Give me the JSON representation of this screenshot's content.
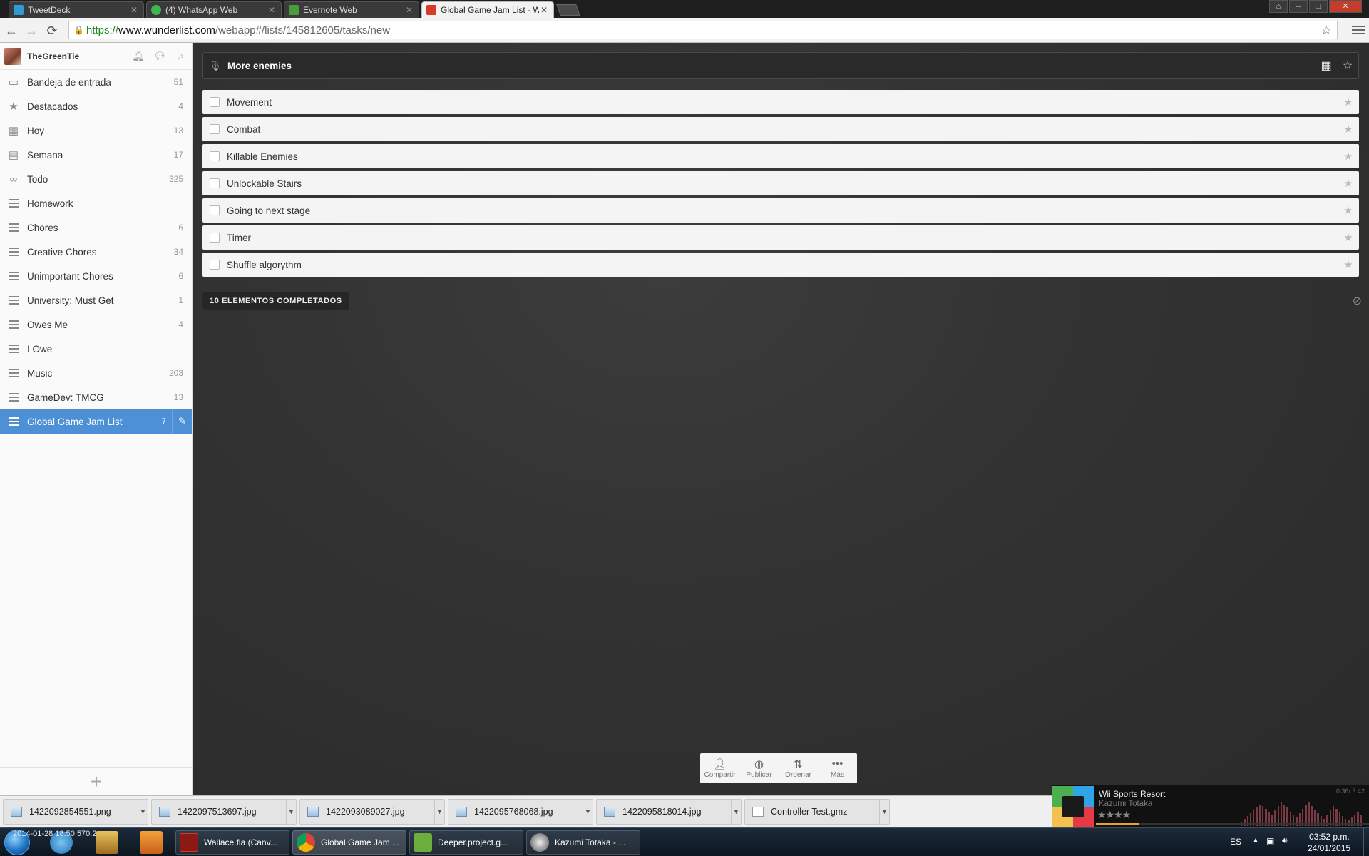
{
  "browser": {
    "tabs": [
      {
        "title": "TweetDeck",
        "icon": "tweetdeck-icon",
        "color": "#2d9bd8"
      },
      {
        "title": "(4) WhatsApp Web",
        "icon": "whatsapp-icon",
        "color": "#3cb853"
      },
      {
        "title": "Evernote Web",
        "icon": "evernote-icon",
        "color": "#4a9b3d"
      },
      {
        "title": "Global Game Jam List - W",
        "icon": "wunderlist-icon",
        "color": "#d63b2a"
      }
    ],
    "url_protocol": "https://",
    "url_host": "www.wunderlist.com",
    "url_path": "/webapp#/lists/145812605/tasks/new"
  },
  "sidebar": {
    "username": "TheGreenTie",
    "items": [
      {
        "label": "Bandeja de entrada",
        "count": "51",
        "icon": "inbox-icon"
      },
      {
        "label": "Destacados",
        "count": "4",
        "icon": "star-icon"
      },
      {
        "label": "Hoy",
        "count": "13",
        "icon": "calendar-today-icon"
      },
      {
        "label": "Semana",
        "count": "17",
        "icon": "calendar-week-icon"
      },
      {
        "label": "Todo",
        "count": "325",
        "icon": "infinity-icon"
      },
      {
        "label": "Homework",
        "count": "",
        "icon": "list-icon"
      },
      {
        "label": "Chores",
        "count": "6",
        "icon": "list-icon"
      },
      {
        "label": "Creative Chores",
        "count": "34",
        "icon": "list-icon"
      },
      {
        "label": "Unimportant Chores",
        "count": "6",
        "icon": "list-icon"
      },
      {
        "label": "University: Must Get",
        "count": "1",
        "icon": "list-icon"
      },
      {
        "label": "Owes Me",
        "count": "4",
        "icon": "list-icon"
      },
      {
        "label": "I Owe",
        "count": "",
        "icon": "list-icon"
      },
      {
        "label": "Music",
        "count": "203",
        "icon": "list-icon"
      },
      {
        "label": "GameDev: TMCG",
        "count": "13",
        "icon": "list-icon"
      },
      {
        "label": "Global Game Jam List",
        "count": "7",
        "icon": "list-icon",
        "active": true
      }
    ]
  },
  "main": {
    "input_value": "More enemies",
    "tasks": [
      "Movement",
      "Combat",
      "Killable Enemies",
      "Unlockable Stairs",
      "Going to next stage",
      "Timer",
      "Shuffle algorythm"
    ],
    "completed_label": "10 ELEMENTOS COMPLETADOS",
    "bottom_actions": [
      {
        "label": "Compartir",
        "icon": "share-user-icon"
      },
      {
        "label": "Publicar",
        "icon": "globe-icon"
      },
      {
        "label": "Ordenar",
        "icon": "sort-icon"
      },
      {
        "label": "Más",
        "icon": "more-dots-icon"
      }
    ]
  },
  "downloads": [
    {
      "name": "1422092854551.png",
      "type": "image"
    },
    {
      "name": "1422097513697.jpg",
      "type": "image"
    },
    {
      "name": "1422093089027.jpg",
      "type": "image"
    },
    {
      "name": "1422095768068.jpg",
      "type": "image"
    },
    {
      "name": "1422095818014.jpg",
      "type": "image"
    },
    {
      "name": "Controller Test.gmz",
      "type": "document"
    }
  ],
  "music": {
    "title": "Wii Sports Resort",
    "artist": "Kazumi Totaka",
    "rating_stars": "★★★★",
    "time": "0:36/ 3:42",
    "progress": 0.16
  },
  "taskbar": {
    "desktop_text": "2014-01-28 18:50 570.2",
    "apps": [
      {
        "label": "Wallace.fla (Canv...",
        "icon": "flash-icon"
      },
      {
        "label": "Global Game Jam ...",
        "icon": "chrome-icon"
      },
      {
        "label": "Deeper.project.g...",
        "icon": "gamemaker-icon"
      },
      {
        "label": "Kazumi Totaka - ...",
        "icon": "foobar-icon"
      }
    ],
    "lang": "ES",
    "time": "03:52 p.m.",
    "date": "24/01/2015"
  }
}
